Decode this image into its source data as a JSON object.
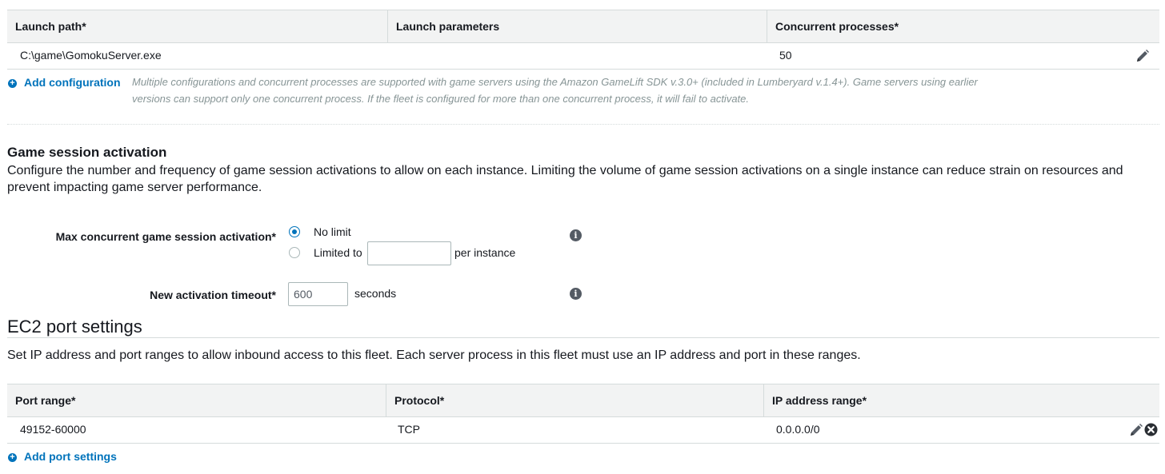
{
  "launch_table": {
    "headers": [
      "Launch path*",
      "Launch parameters",
      "Concurrent processes*"
    ],
    "rows": [
      {
        "launch_path": "C:\\game\\GomokuServer.exe",
        "launch_parameters": "",
        "concurrent_processes": "50"
      }
    ],
    "edit_icon": "pencil-icon"
  },
  "add_configuration": {
    "label": "Add configuration",
    "icon": "plus-circle-icon",
    "note_line1": "Multiple configurations and concurrent processes are supported with game servers using the Amazon GameLift SDK v.3.0+ (included in Lumberyard v.1.4+). Game servers using earlier",
    "note_line2": "versions can support only one concurrent process. If the fleet is configured for more than one concurrent process, it will fail to activate."
  },
  "game_session_activation": {
    "title": "Game session activation",
    "description_line1": "Configure the number and frequency of game session activations to allow on each instance. Limiting the volume of game session activations on a single instance can reduce strain on resources and",
    "description_line2": "prevent impacting game server performance.",
    "max_concurrent": {
      "label": "Max concurrent game session activation*",
      "options": [
        "No limit",
        "Limited to"
      ],
      "selected": "No limit",
      "limited_value": "",
      "suffix": "per instance",
      "info_icon": "info-icon"
    },
    "timeout": {
      "label": "New activation timeout*",
      "value": "600",
      "unit": "seconds",
      "info_icon": "info-icon"
    }
  },
  "ec2_port_settings": {
    "title": "EC2 port settings",
    "description": "Set IP address and port ranges to allow inbound access to this fleet. Each server process in this fleet must use an IP address and port in these ranges.",
    "headers": [
      "Port range*",
      "Protocol*",
      "IP address range*"
    ],
    "rows": [
      {
        "port_range": "49152-60000",
        "protocol": "TCP",
        "ip_range": "0.0.0.0/0"
      }
    ],
    "add_label": "Add port settings"
  },
  "colors": {
    "link": "#0073bb",
    "header_bg": "#f2f3f3",
    "border": "#d5dbdb",
    "note": "#879596"
  }
}
